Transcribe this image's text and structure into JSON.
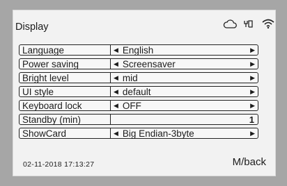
{
  "title": "Display",
  "status_icons": [
    "cloud-icon",
    "usb-icon",
    "wifi-icon"
  ],
  "menu": [
    {
      "label": "Language",
      "value": "English",
      "type": "select"
    },
    {
      "label": "Power saving",
      "value": "Screensaver",
      "type": "select"
    },
    {
      "label": "Bright level",
      "value": "mid",
      "type": "select"
    },
    {
      "label": "UI style",
      "value": "default",
      "type": "select"
    },
    {
      "label": "Keyboard lock",
      "value": "OFF",
      "type": "select"
    },
    {
      "label": "Standby (min)",
      "value": "1",
      "type": "number"
    },
    {
      "label": "ShowCard",
      "value": "Big Endian-3byte",
      "type": "select"
    }
  ],
  "footer": {
    "datetime": "02-11-2018  17:13:27",
    "back_label": "M/back"
  }
}
